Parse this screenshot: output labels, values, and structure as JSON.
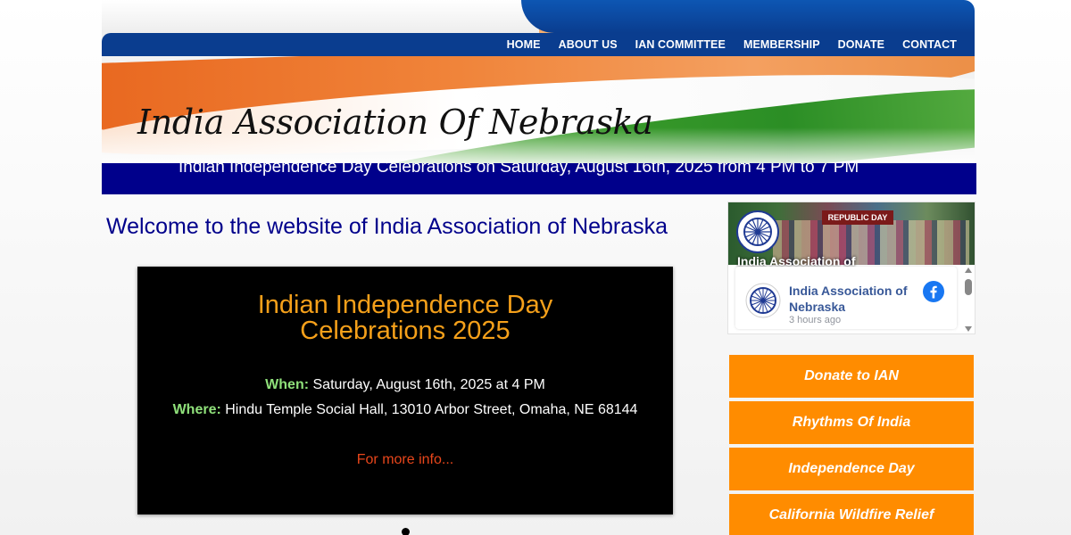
{
  "nav": {
    "items": [
      "HOME",
      "ABOUT US",
      "IAN COMMITTEE",
      "MEMBERSHIP",
      "DONATE",
      "CONTACT"
    ]
  },
  "header": {
    "site_title": "India Association Of Nebraska",
    "marquee": "Indian Independence Day Celebrations on Saturday, August 16th, 2025 from 4 PM to 7 PM"
  },
  "main": {
    "welcome": "Welcome to the website of India Association of Nebraska",
    "slide": {
      "title_line1": "Indian Independence Day",
      "title_line2": "Celebrations 2025",
      "when_label": "When:",
      "when_value": " Saturday, August 16th, 2025 at 4 PM",
      "where_label": "Where:",
      "where_value": " Hindu Temple Social Hall, 13010 Arbor Street, Omaha, NE 68144",
      "more_link": "For more info..."
    }
  },
  "sidebar": {
    "facebook": {
      "cover_page_name": "India Association of",
      "cover_banner": "REPUBLIC DAY",
      "post_page_name": "India Association of Nebraska",
      "post_time": "3 hours ago"
    },
    "buttons": [
      "Donate to IAN",
      "Rhythms Of India",
      "Independence Day",
      "California Wildfire Relief"
    ]
  },
  "colors": {
    "nav_blue": "#0a3d8f",
    "marquee_bg": "#00008b",
    "welcome_text": "#00008b",
    "slide_title": "#f5a01a",
    "label_green": "#8fe07a",
    "link_red": "#e8461b",
    "button_orange": "#ff8c00",
    "fb_blue": "#385898"
  }
}
